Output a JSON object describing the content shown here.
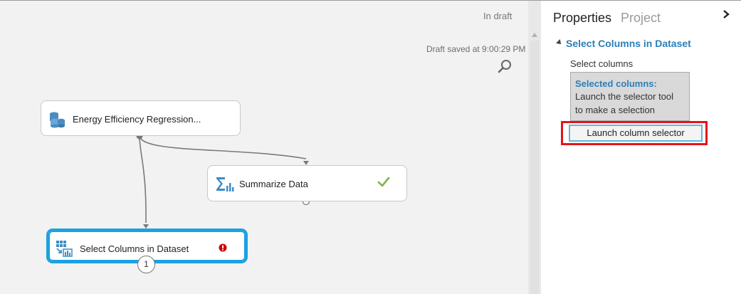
{
  "canvas": {
    "status_draft": "In draft",
    "status_saved": "Draft saved at 9:00:29 PM",
    "nodes": {
      "energy": {
        "label": "Energy Efficiency Regression..."
      },
      "summarize": {
        "label": "Summarize Data"
      },
      "select": {
        "label": "Select Columns in Dataset",
        "port_number": "1"
      }
    }
  },
  "panel": {
    "tabs": {
      "properties": "Properties",
      "project": "Project"
    },
    "section_title": "Select Columns in Dataset",
    "field_label": "Select columns",
    "selected_title": "Selected columns:",
    "selected_text_line1": "Launch the selector tool",
    "selected_text_line2": "to make a selection",
    "launch_button": "Launch column selector"
  },
  "colors": {
    "accent_blue": "#2b7fb8",
    "selection_outline": "#1ba1e2",
    "highlight_red": "#e3151a",
    "success_green": "#7ab648",
    "error_red": "#cc0000"
  }
}
